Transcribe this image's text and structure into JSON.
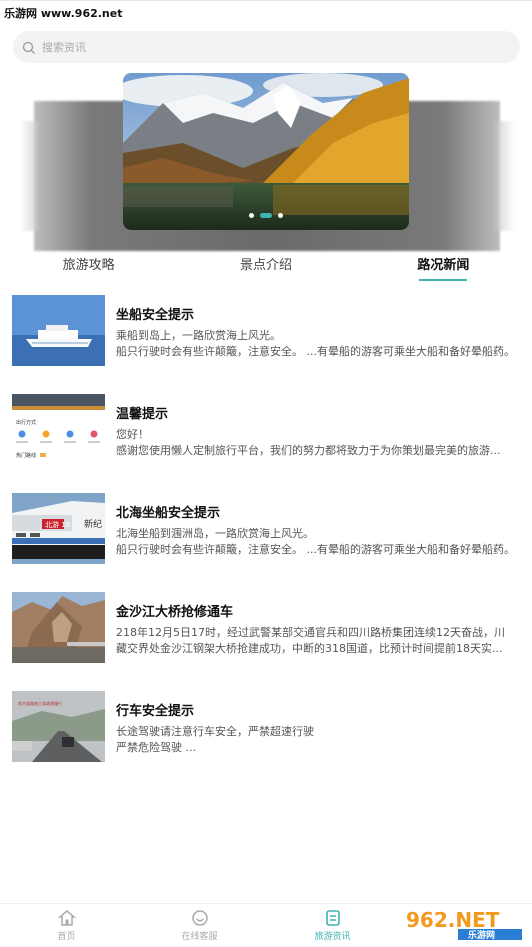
{
  "watermark": "乐游网 www.962.net",
  "search": {
    "placeholder": "搜索资讯"
  },
  "banner": {
    "dots": 3,
    "active_dot": 1
  },
  "tabs": [
    {
      "label": "旅游攻略",
      "active": false
    },
    {
      "label": "景点介绍",
      "active": false
    },
    {
      "label": "路况新闻",
      "active": true
    }
  ],
  "news": [
    {
      "title": "坐船安全提示",
      "line1": "乘船到岛上，一路欣赏海上风光。",
      "line2": "船只行驶时会有些许颠簸，注意安全。 ...有晕船的游客可乘坐大船和备好晕船药。"
    },
    {
      "title": "温馨提示",
      "line1": "您好！",
      "line2": "感谢您使用懒人定制旅行平台，我们的努力都将致力于为你策划最完美的旅游..."
    },
    {
      "title": "北海坐船安全提示",
      "line1": "北海坐船到涠洲岛，一路欣赏海上风光。",
      "line2": "船只行驶时会有些许颠簸，注意安全。 ...有晕船的游客可乘坐大船和备好晕船药。"
    },
    {
      "title": "金沙江大桥抢修通车",
      "line1": "218年12月5日17时，经过武警某部交通官兵和四川路桥集团连续12天奋战，川",
      "line2": "藏交界处金沙江钢架大桥抢建成功，中断的318国道，比预计时间提前18天实..."
    },
    {
      "title": "行车安全提示",
      "line1": "长途驾驶请注意行车安全，严禁超速行驶",
      "line2": "严禁危险驾驶 ..."
    }
  ],
  "thumb2": {
    "menu_title": "出行方式",
    "bottom_text": "热门路线"
  },
  "thumb3": {
    "ship_text": "北游 16",
    "ship_text2": "新纪"
  },
  "thumb5": {
    "sign_text": "前方道路施工请减速慢行"
  },
  "bottom_nav": [
    {
      "label": "首页",
      "icon": "home-icon",
      "active": false
    },
    {
      "label": "在线客服",
      "icon": "chat-icon",
      "active": false
    },
    {
      "label": "旅游资讯",
      "icon": "news-icon",
      "active": true
    }
  ],
  "logo": {
    "text": "962.NET",
    "sub": "乐游网"
  },
  "colors": {
    "accent": "#3fb3b0"
  }
}
